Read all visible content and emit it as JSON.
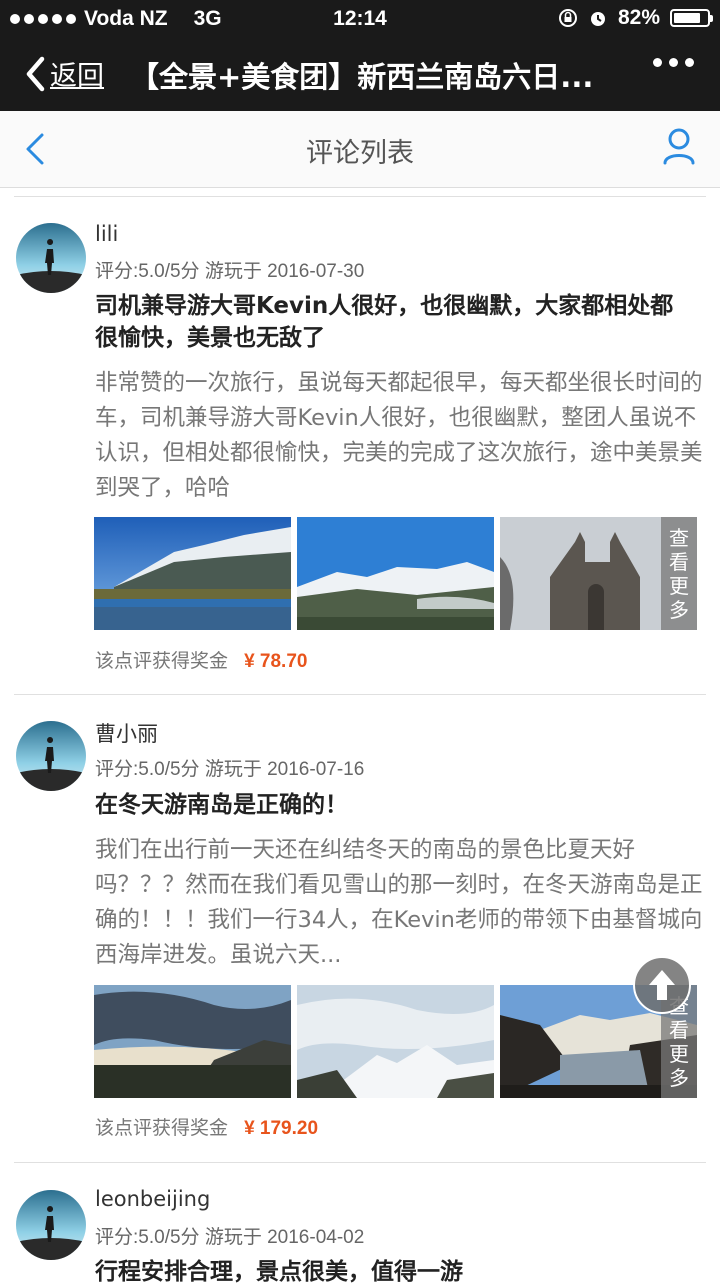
{
  "status": {
    "carrier": "Voda NZ",
    "network": "3G",
    "time": "12:14",
    "battery": "82%",
    "battery_level": 0.82
  },
  "nav": {
    "back_label": "返回",
    "title": "【全景+美食团】新西兰南岛六日..."
  },
  "header": {
    "title": "评论列表"
  },
  "reviews": [
    {
      "user": "lili",
      "meta": "评分:5.0/5分 游玩于 2016-07-30",
      "title": "司机兼导游大哥Kevin人很好，也很幽默，大家都相处都很愉快，美景也无敌了",
      "body": "非常赞的一次旅行，虽说每天都起很早，每天都坐很长时间的车，司机兼导游大哥Kevin人很好，也很幽默，整团人虽说不认识，但相处都很愉快，完美的完成了这次旅行，途中美景美到哭了，哈哈",
      "more_label": "查看更多",
      "reward_label": "该点评获得奖金",
      "reward_amount": "¥ 78.70"
    },
    {
      "user": "曹小丽",
      "meta": "评分:5.0/5分 游玩于 2016-07-16",
      "title": "在冬天游南岛是正确的！",
      "body": "我们在出行前一天还在纠结冬天的南岛的景色比夏天好吗？？？然而在我们看见雪山的那一刻时，在冬天游南岛是正确的！！！我们一行34人，在Kevin老师的带领下由基督城向西海岸进发。虽说六天...",
      "more_label": "查看更多",
      "reward_label": "该点评获得奖金",
      "reward_amount": "¥ 179.20"
    },
    {
      "user": "leonbeijing",
      "meta": "评分:5.0/5分 游玩于 2016-04-02",
      "title": "行程安排合理，景点很美，值得一游"
    }
  ],
  "icons": [
    "back-chevron-icon",
    "more-dots-icon",
    "user-icon",
    "back-to-top-icon",
    "alarm-icon",
    "lock-rotation-icon"
  ],
  "colors": {
    "bar": "#1a1a1a",
    "accent": "#2b8be0",
    "price": "#e8541c"
  }
}
